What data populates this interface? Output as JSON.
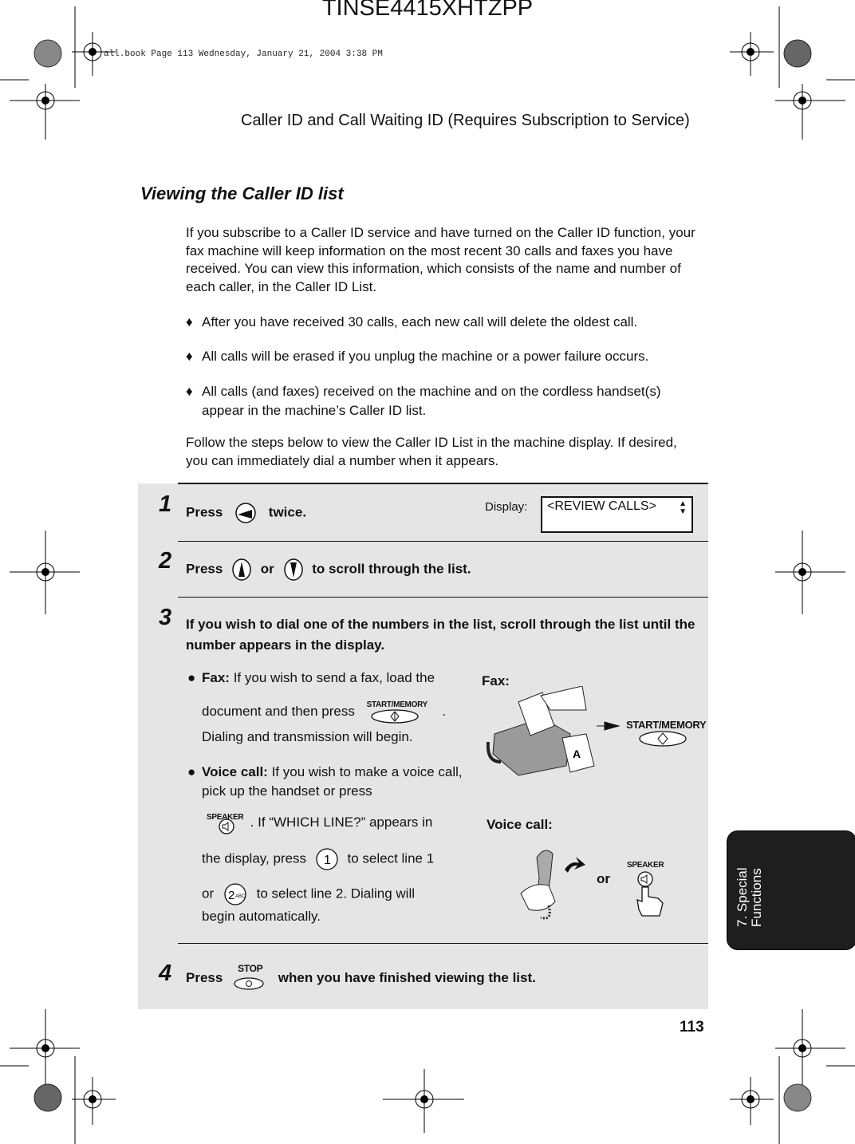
{
  "doc_id": "TINSE4415XHTZPP",
  "book_info": "all.book  Page 113  Wednesday, January 21, 2004  3:38 PM",
  "running_header": "Caller ID and Call Waiting ID (Requires Subscription to Service)",
  "section_title": "Viewing the Caller ID list",
  "intro": "If you subscribe to a Caller ID service and have turned on the Caller ID function, your fax machine will keep information on the most recent 30 calls and faxes you have received. You can view this information, which consists of the name and number of each caller, in the Caller ID List.",
  "bullets": [
    "After you have received 30 calls, each new call will delete the oldest call.",
    "All calls will be erased if you unplug the machine or a power failure occurs.",
    "All calls (and faxes) received on the machine and on the cordless handset(s) appear in the machine’s Caller ID list."
  ],
  "follow": "Follow the steps below to view the Caller ID List in the machine display. If desired, you can immediately dial a number when it appears.",
  "steps": {
    "s1": {
      "num": "1",
      "pre": "Press",
      "post": "twice."
    },
    "display_label": "Display:",
    "display_value": "<REVIEW CALLS>",
    "s2": {
      "num": "2",
      "pre": "Press",
      "mid": "or",
      "post": "to  scroll through the list."
    },
    "s3": {
      "num": "3",
      "text": "If you wish to dial one of the numbers in the list, scroll through the list until the number appears in the display."
    },
    "fax": {
      "label": "Fax:",
      "t1": "If you wish to send a fax, load the",
      "t2": "document and then press",
      "t3": ".",
      "t4": "Dialing and transmission will begin."
    },
    "voice": {
      "label": "Voice call:",
      "t1": "If you wish to make a voice call, pick up the handset or press",
      "t2": ". If “WHICH LINE?” appears in",
      "t3": "the display, press",
      "t4": "to select line 1",
      "t5": "or",
      "t6": "to select line 2. Dialing will",
      "t7": "begin automatically."
    },
    "s4": {
      "num": "4",
      "pre": "Press",
      "post": "when you have finished viewing the list."
    },
    "illus": {
      "fax_label": "Fax:",
      "voice_label": "Voice call:",
      "or": "or"
    }
  },
  "keys": {
    "start_memory": "START/MEMORY",
    "speaker": "SPEAKER",
    "stop": "STOP",
    "one": "1",
    "two": "2",
    "two_sub": "ABC"
  },
  "tab": {
    "line1": "7. Special",
    "line2": "Functions"
  },
  "page_number": "113"
}
